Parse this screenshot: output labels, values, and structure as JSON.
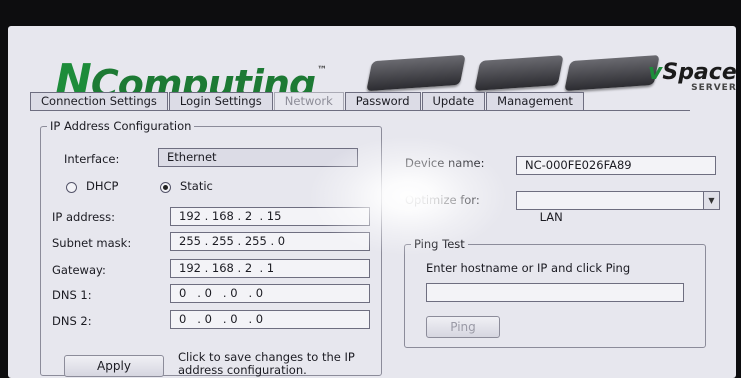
{
  "header": {
    "logo_n": "N",
    "logo_rest": "Computing",
    "logo_tm": "™",
    "product_v": "v",
    "product_space": "Space",
    "product_sub": "SERVER"
  },
  "tabs": [
    {
      "label": "Connection Settings",
      "active": false
    },
    {
      "label": "Login Settings",
      "active": false
    },
    {
      "label": "Network",
      "active": true
    },
    {
      "label": "Password",
      "active": false
    },
    {
      "label": "Update",
      "active": false
    },
    {
      "label": "Management",
      "active": false
    }
  ],
  "ip_config": {
    "legend": "IP Address Configuration",
    "interface_label": "Interface:",
    "interface_value": "Ethernet",
    "dhcp_label": "DHCP",
    "static_label": "Static",
    "selected_mode": "Static",
    "ip_label": "IP address:",
    "ip_value": "192 . 168 . 2  . 15",
    "mask_label": "Subnet mask:",
    "mask_value": "255 . 255 . 255 . 0",
    "gateway_label": "Gateway:",
    "gateway_value": "192 . 168 . 2  . 1",
    "dns1_label": "DNS 1:",
    "dns1_value": "0   . 0   . 0   . 0",
    "dns2_label": "DNS 2:",
    "dns2_value": "0   . 0   . 0   . 0",
    "apply_label": "Apply",
    "apply_hint": "Click to save changes to the IP address configuration."
  },
  "device": {
    "name_label": "Device name:",
    "name_value": "NC-000FE026FA89",
    "optimize_label": "Optimize for:",
    "optimize_value": "LAN"
  },
  "ping": {
    "legend": "Ping Test",
    "instruction": "Enter hostname or IP and click Ping",
    "input_value": "",
    "button_label": "Ping"
  },
  "colors": {
    "brand_green": "#1d8c3a",
    "panel_bg": "#e7e7ee"
  }
}
